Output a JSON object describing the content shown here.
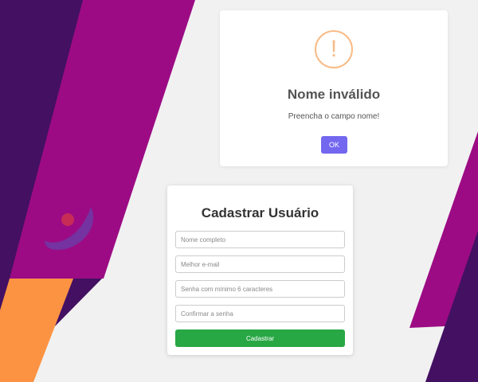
{
  "colors": {
    "dark_purple": "#431062",
    "magenta": "#9c0b84",
    "orange": "#fc9343",
    "light_bg": "#f1f1f1",
    "logo_dot": "#c72c56",
    "logo_arc": "#6e3aa6",
    "warning": "#f8bb86",
    "ok_button": "#7367f0",
    "submit_button": "#28a745"
  },
  "alert": {
    "icon": "exclamation-icon",
    "icon_glyph": "!",
    "title": "Nome inválido",
    "text": "Preencha o campo nome!",
    "ok_label": "OK"
  },
  "form": {
    "title": "Cadastrar Usuário",
    "fields": [
      {
        "placeholder": "Nome completo",
        "value": ""
      },
      {
        "placeholder": "Melhor e-mail",
        "value": ""
      },
      {
        "placeholder": "Senha com mínimo 6 caracteres",
        "value": ""
      },
      {
        "placeholder": "Confirmar a senha",
        "value": ""
      }
    ],
    "submit_label": "Cadastrar"
  }
}
